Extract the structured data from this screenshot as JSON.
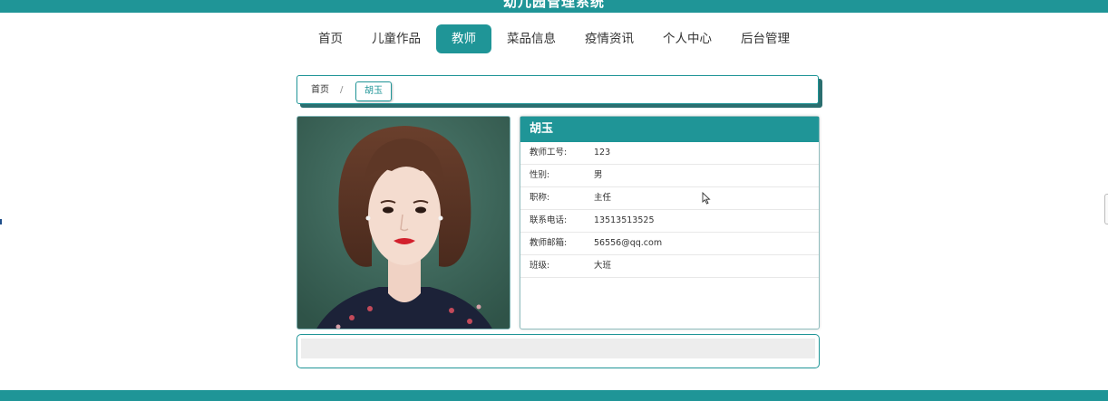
{
  "app": {
    "site_title": "幼儿园管理系统"
  },
  "nav": {
    "items": [
      {
        "label": "首页",
        "active": false
      },
      {
        "label": "儿童作品",
        "active": false
      },
      {
        "label": "教师",
        "active": true
      },
      {
        "label": "菜品信息",
        "active": false
      },
      {
        "label": "疫情资讯",
        "active": false
      },
      {
        "label": "个人中心",
        "active": false
      },
      {
        "label": "后台管理",
        "active": false
      }
    ]
  },
  "breadcrumb": {
    "home": "首页",
    "separator": "/",
    "current": "胡玉"
  },
  "teacher": {
    "name": "胡玉",
    "fields": [
      {
        "label": "教师工号:",
        "value": "123"
      },
      {
        "label": "性别:",
        "value": "男"
      },
      {
        "label": "职称:",
        "value": "主任"
      },
      {
        "label": "联系电话:",
        "value": "13513513525"
      },
      {
        "label": "教师邮箱:",
        "value": "56556@qq.com"
      },
      {
        "label": "班级:",
        "value": "大班"
      }
    ]
  },
  "colors": {
    "accent": "#1f9597",
    "shadow": "#2b6e6f"
  },
  "icons": {
    "cursor": "mouse-pointer-icon"
  }
}
